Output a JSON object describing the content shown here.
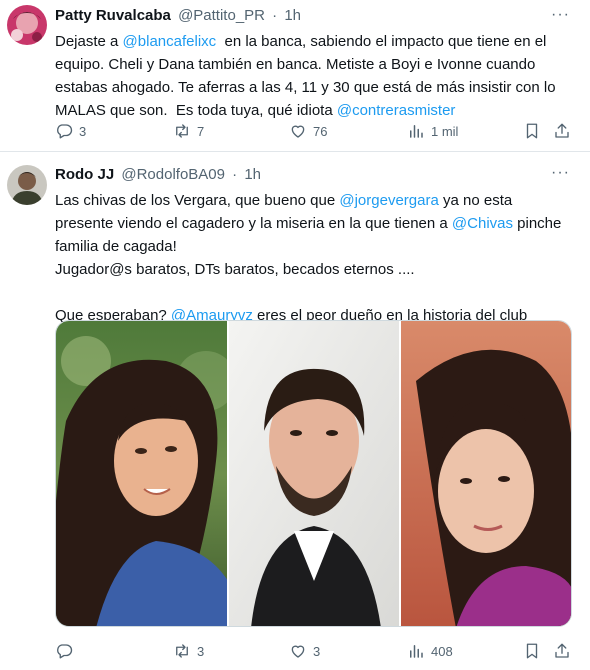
{
  "tweets": [
    {
      "author_name": "Patty Ruvalcaba",
      "author_handle": "@Pattito_PR",
      "separator": "·",
      "time": "1h",
      "more": "···",
      "lines": [
        [
          {
            "t": "Dejaste a "
          },
          {
            "t": "@blancafelixc",
            "link": true
          },
          {
            "t": "  en la banca, sabiendo el impacto que tiene en el"
          }
        ],
        [
          {
            "t": "equipo. Cheli y Dana también en banca. Metiste a Boyi e Ivonne cuando"
          }
        ],
        [
          {
            "t": "estabas ahogado. Te aferras a las 4, 11 y 30 que está de más insistir con lo"
          }
        ],
        [
          {
            "t": "MALAS que son.  Es toda tuya, qué idiota "
          },
          {
            "t": "@contrerasmister",
            "link": true
          }
        ]
      ],
      "replies": "3",
      "retweets": "7",
      "likes": "76",
      "views": "1 mil"
    },
    {
      "author_name": "Rodo JJ",
      "author_handle": "@RodolfoBA09",
      "separator": "·",
      "time": "1h",
      "more": "···",
      "lines": [
        [
          {
            "t": "Las chivas de los Vergara, que bueno que "
          },
          {
            "t": "@jorgevergara",
            "link": true
          },
          {
            "t": " ya no esta"
          }
        ],
        [
          {
            "t": "presente viendo el cagadero y la miseria en la que tienen a "
          },
          {
            "t": "@Chivas",
            "link": true
          },
          {
            "t": " pinche"
          }
        ],
        [
          {
            "t": "familia de cagada!"
          }
        ],
        [
          {
            "t": "Jugador@s baratos, DTs baratos, becados eternos ...."
          }
        ],
        [
          {
            "t": ""
          }
        ],
        [
          {
            "t": "Que esperaban? "
          },
          {
            "t": "@Amauryvz",
            "link": true
          },
          {
            "t": " eres el peor dueño en la historia del club"
          }
        ]
      ],
      "replies": "",
      "retweets": "3",
      "likes": "3",
      "views": "408"
    }
  ],
  "colors": {
    "link": "#1d9bf0",
    "muted": "#536471",
    "text": "#0f1419",
    "divider": "#e1e6ea"
  },
  "icons": [
    "reply-icon",
    "retweet-icon",
    "like-icon",
    "views-icon",
    "bookmark-icon",
    "share-icon",
    "more-icon"
  ]
}
